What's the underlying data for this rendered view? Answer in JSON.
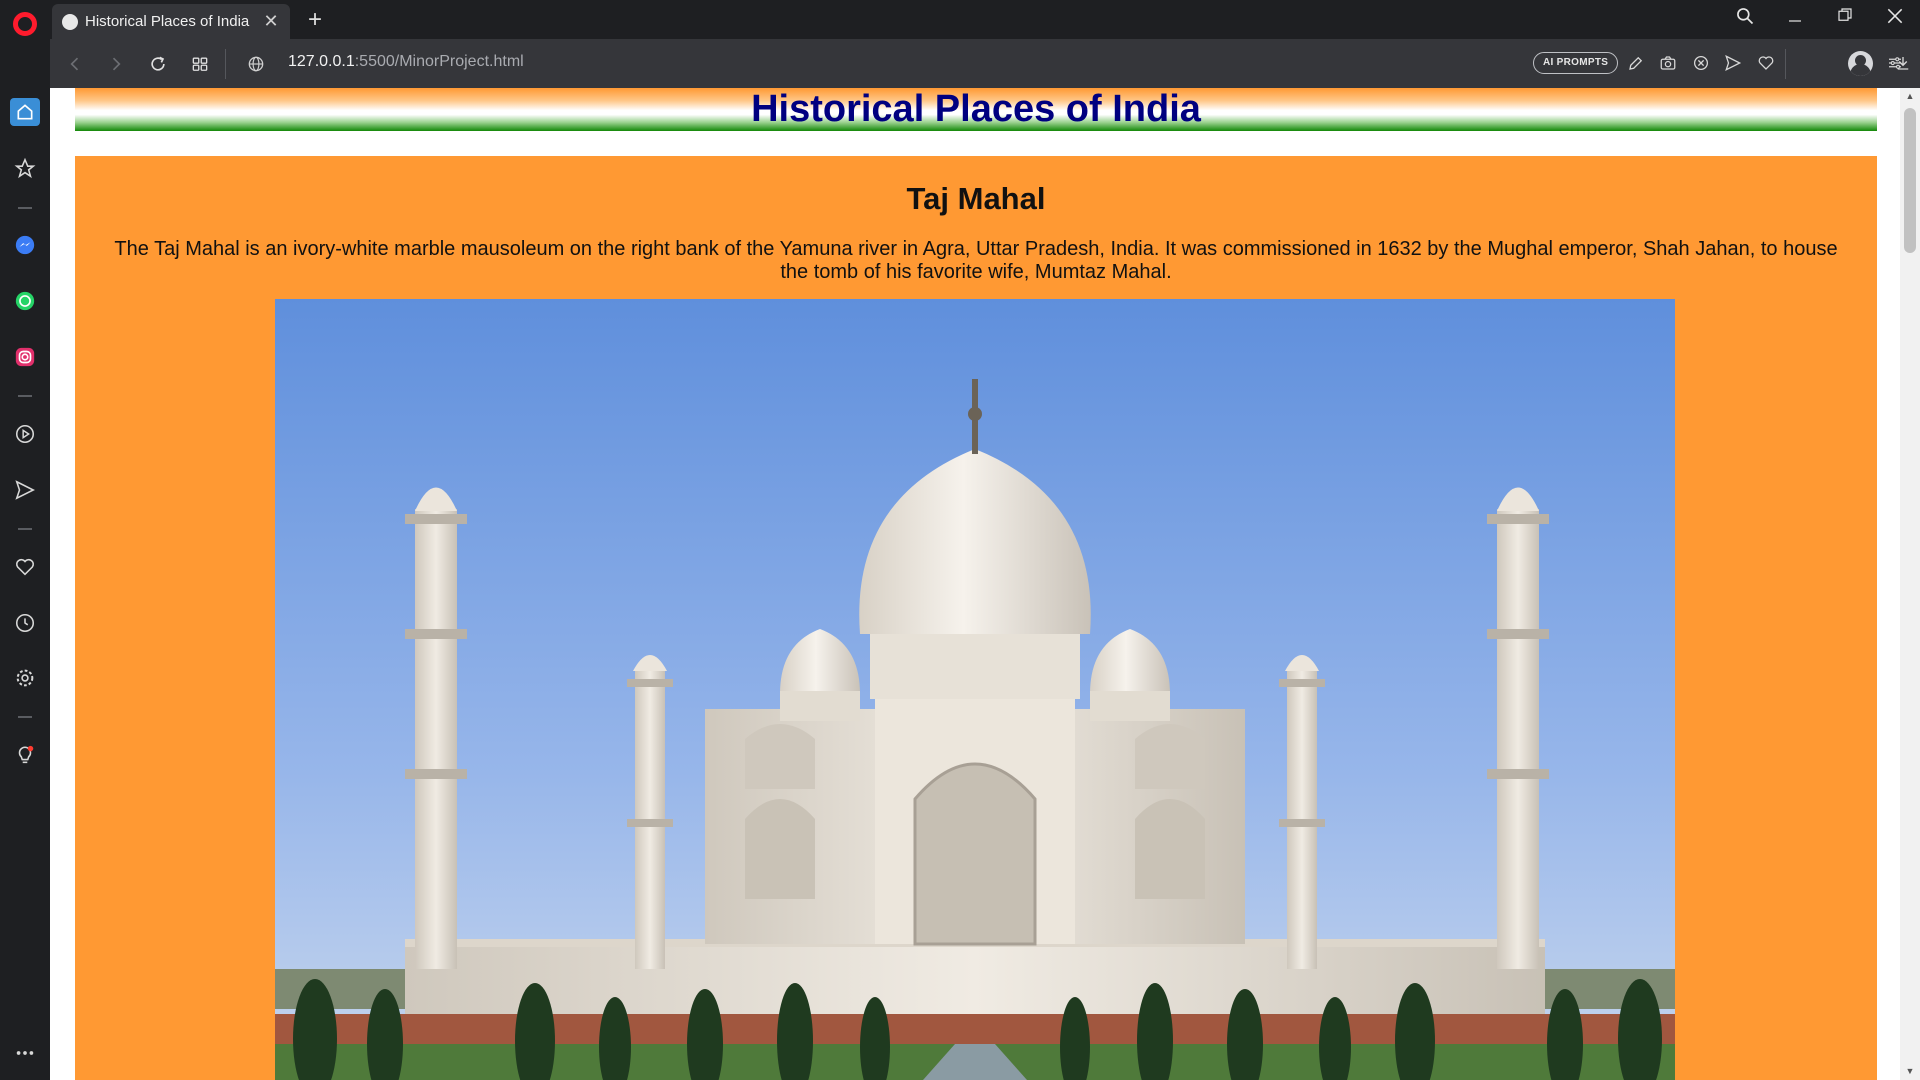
{
  "browser": {
    "tab_title": "Historical Places of India",
    "url_host": "127.0.0.1",
    "url_path": ":5500/MinorProject.html",
    "ai_prompts_label": "AI PROMPTS"
  },
  "page": {
    "title": "Historical Places of India",
    "section": {
      "heading": "Taj Mahal",
      "description": "The Taj Mahal is an ivory-white marble mausoleum on the right bank of the Yamuna river in Agra, Uttar Pradesh, India. It was commissioned in 1632 by the Mughal emperor, Shah Jahan, to house the tomb of his favorite wife, Mumtaz Mahal.",
      "image_alt": "Taj Mahal photograph"
    }
  },
  "colors": {
    "saffron": "#ff9933",
    "green": "#138808",
    "navy": "#000080"
  }
}
